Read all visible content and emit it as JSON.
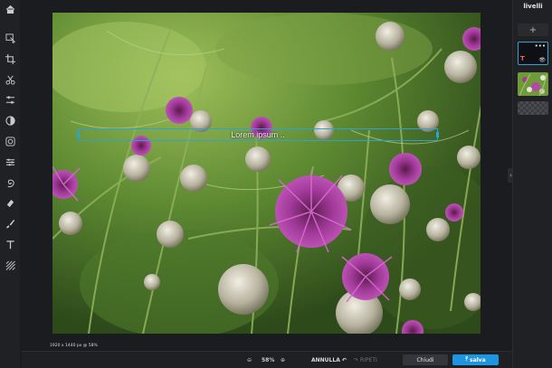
{
  "app": {
    "layers_title": "livelli"
  },
  "left_toolbar": {
    "tools": [
      {
        "name": "home-icon"
      },
      {
        "name": "move-select-icon"
      },
      {
        "name": "crop-icon"
      },
      {
        "name": "cut-icon"
      },
      {
        "name": "adjust-icon"
      },
      {
        "name": "contrast-icon"
      },
      {
        "name": "filter-icon"
      },
      {
        "name": "sliders-icon"
      },
      {
        "name": "spiral-icon"
      },
      {
        "name": "eraser-icon"
      },
      {
        "name": "brush-icon"
      },
      {
        "name": "text-icon"
      },
      {
        "name": "pattern-icon"
      }
    ]
  },
  "canvas": {
    "text_layer_content": "Lorem ipsum ..",
    "dimensions_label": "1920 x 1440 px @ 58%"
  },
  "layers": {
    "add_label": "+",
    "text_layer_icon": "T",
    "more_label": "•••",
    "eye_label": "👁"
  },
  "bottom_bar": {
    "zoom_out": "⊖",
    "zoom_value": "58%",
    "zoom_in": "⊕",
    "undo_label": "ANNULLA",
    "redo_label": "RIPETI",
    "close_label": "Chiudi",
    "save_label": "salva"
  },
  "colors": {
    "accent": "#1f95e0",
    "selection": "#2aa3d6",
    "panel": "#202124"
  }
}
